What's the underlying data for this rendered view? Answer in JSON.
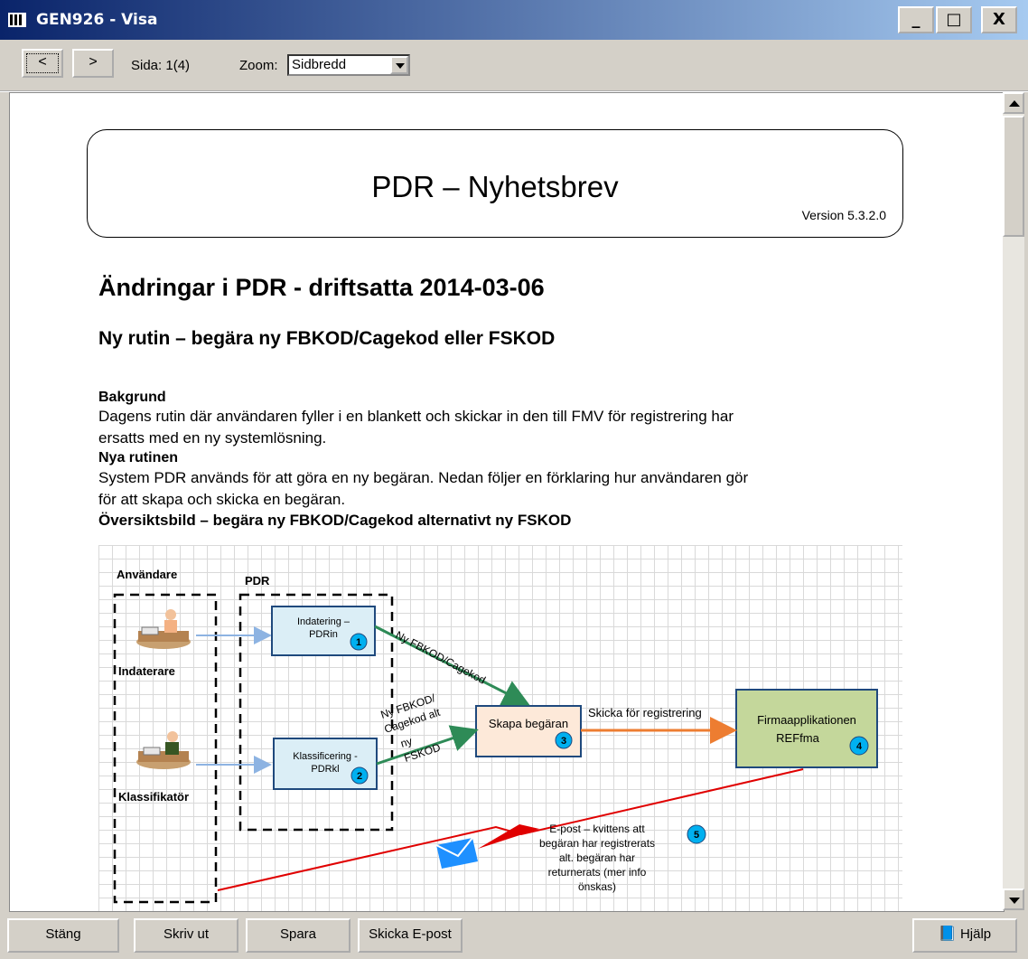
{
  "window": {
    "title": "GEN926 - Visa",
    "minimize": "_",
    "maximize": "□",
    "close": "X"
  },
  "toolbar": {
    "prev": "<",
    "next": ">",
    "page_label": "Sida: 1(4)",
    "zoom_label": "Zoom:",
    "zoom_value": "Sidbredd"
  },
  "document": {
    "header_title": "PDR – Nyhetsbrev",
    "version": "Version 5.3.2.0",
    "h1": "Ändringar i PDR - driftsatta 2014-03-06",
    "h2": "Ny rutin – begära ny FBKOD/Cagekod eller FSKOD",
    "bakgrund_heading": "Bakgrund",
    "bakgrund_line1": "Dagens rutin där användaren fyller i en blankett och skickar in den till FMV för registrering har",
    "bakgrund_line2": "ersatts med en ny systemlösning.",
    "nya_heading": "Nya rutinen",
    "nya_line1": "System PDR används för att göra en ny begäran. Nedan följer en förklaring hur användaren gör",
    "nya_line2": "för att skapa och skicka en begäran.",
    "oversikt_heading": "Översiktsbild – begära ny FBKOD/Cagekod alternativt ny FSKOD"
  },
  "diagram": {
    "lane_users": "Användare",
    "lane_pdr": "PDR",
    "actor_indaterare": "Indaterare",
    "actor_klassifikator": "Klassifikatör",
    "box1_line1": "Indatering –",
    "box1_line2": "PDRin",
    "box2_line1": "Klassificering -",
    "box2_line2": "PDRkl",
    "box3": "Skapa begäran",
    "box4_line1": "Firmaapplikationen",
    "box4_line2": "REFfma",
    "n1": "1",
    "n2": "2",
    "n3": "3",
    "n4": "4",
    "n5": "5",
    "arrow_top": "Ny FBKOD/Cagekod",
    "arrow_mid_1": "Ny FBKOD/",
    "arrow_mid_2": "Cagekod alt",
    "arrow_mid_3": "ny",
    "arrow_mid_4": "FSKOD",
    "arrow_send": "Skicka för registrering",
    "email_1": "E-post – kvittens att",
    "email_2": "begäran har registrerats",
    "email_3": "alt. begäran har",
    "email_4": "returnerats (mer info",
    "email_5": "önskas)"
  },
  "buttons": {
    "close": "Stäng",
    "print": "Skriv ut",
    "save": "Spara",
    "email": "Skicka E-post",
    "help": "Hjälp"
  },
  "colors": {
    "title_start": "#0a246a",
    "title_end": "#a6caf0",
    "chrome": "#d4d0c8",
    "arrow_green": "#2e8b57",
    "arrow_orange": "#ed7d31",
    "arrow_red": "#e00000",
    "box_blue": "#dbeef6",
    "box_peach": "#fde9d9",
    "box_green": "#c4d79b"
  }
}
